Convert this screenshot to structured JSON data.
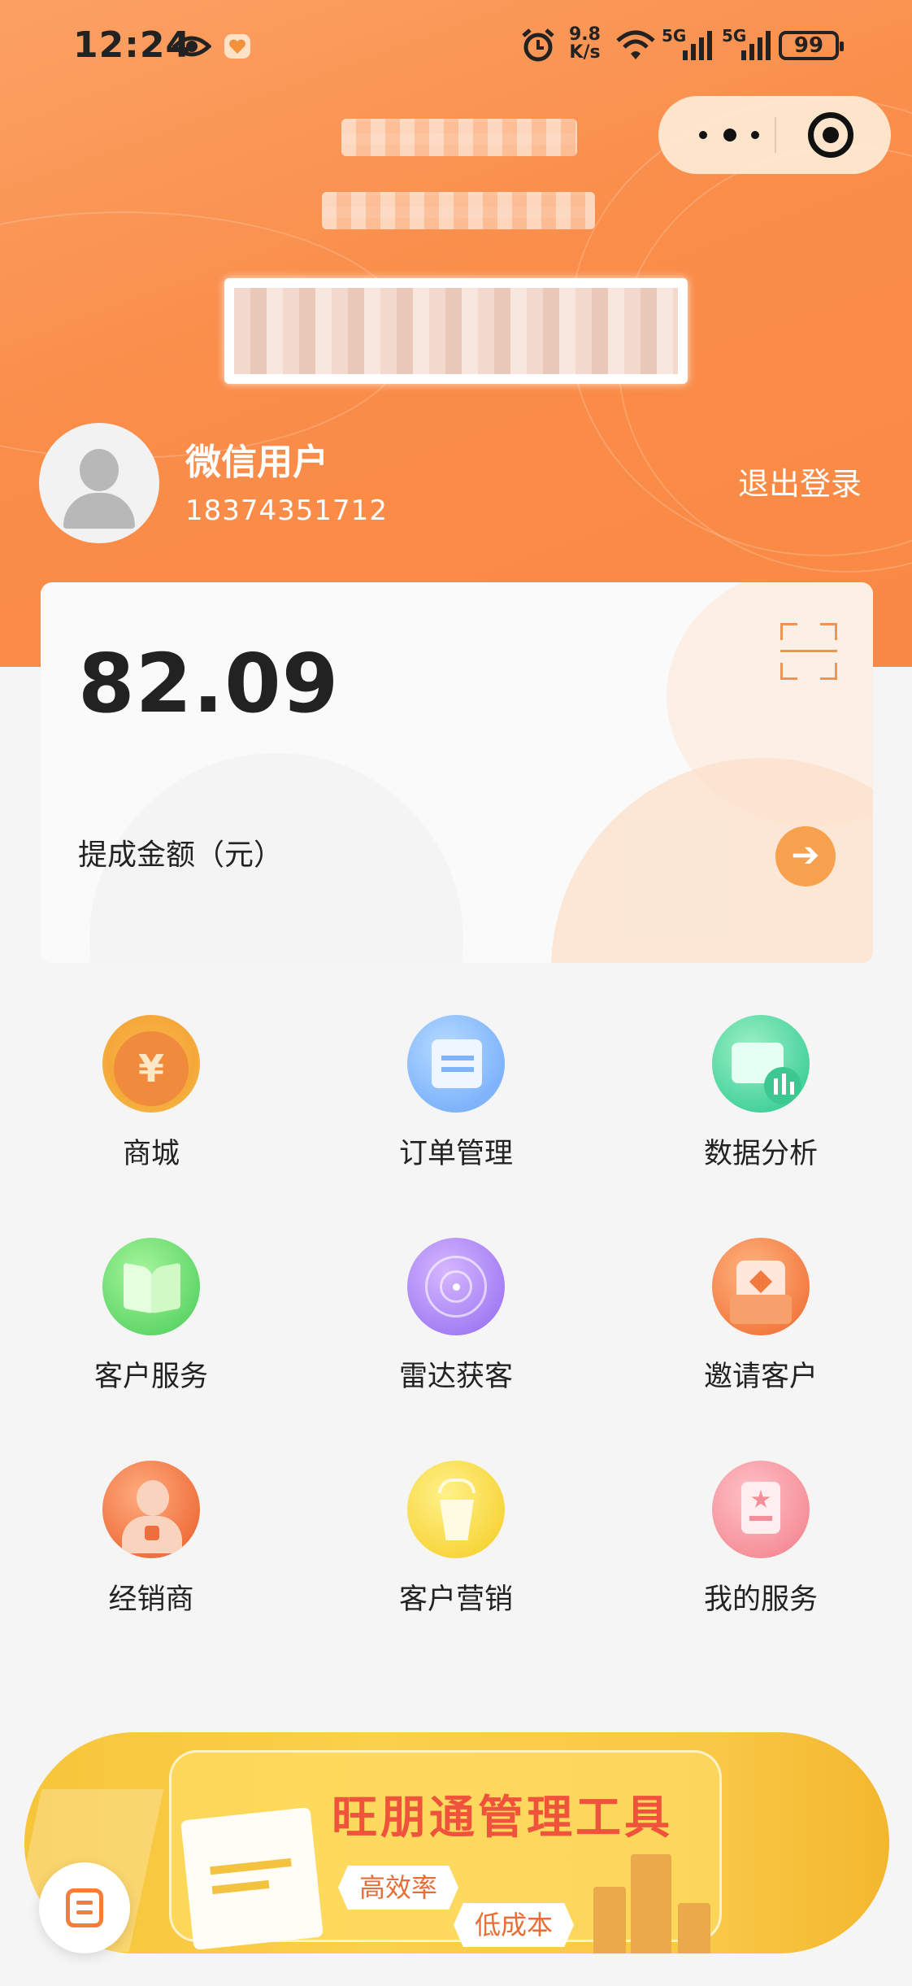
{
  "status_bar": {
    "time": "12:24",
    "net_speed_top": "9.8",
    "net_speed_bottom": "K/s",
    "signal1": "5G",
    "signal2": "5G",
    "battery": "99"
  },
  "user": {
    "name": "微信用户",
    "phone": "18374351712",
    "logout_label": "退出登录"
  },
  "commission": {
    "amount": "82.09",
    "label": "提成金额（元）"
  },
  "grid": [
    {
      "label": "商城",
      "icon": "mall-coin-icon"
    },
    {
      "label": "订单管理",
      "icon": "order-manage-icon"
    },
    {
      "label": "数据分析",
      "icon": "data-analysis-icon"
    },
    {
      "label": "客户服务",
      "icon": "customer-service-icon"
    },
    {
      "label": "雷达获客",
      "icon": "radar-icon"
    },
    {
      "label": "邀请客户",
      "icon": "invite-customer-icon"
    },
    {
      "label": "经销商",
      "icon": "dealer-icon"
    },
    {
      "label": "客户营销",
      "icon": "customer-marketing-icon"
    },
    {
      "label": "我的服务",
      "icon": "my-service-icon"
    }
  ],
  "banner": {
    "title": "旺朋通管理工具",
    "tag1": "高效率",
    "tag2": "低成本"
  },
  "colors": {
    "header": "#fa8d4a",
    "accent": "#f7a04e",
    "banner": "#fbd04a"
  }
}
